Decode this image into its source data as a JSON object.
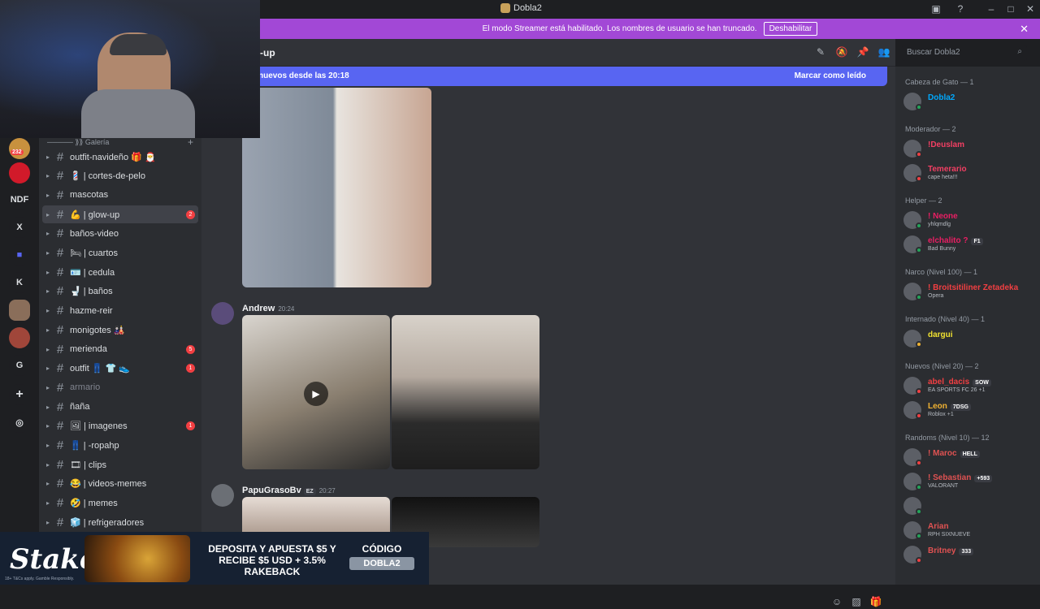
{
  "window": {
    "title": "Dobla2"
  },
  "banner": {
    "text": "El modo Streamer está habilitado. Los nombres de usuario se han truncado.",
    "button": "Deshabilitar"
  },
  "servers": [
    {
      "label": "232"
    },
    {
      "label": ""
    },
    {
      "label": "NDF"
    },
    {
      "label": "X"
    },
    {
      "label": ""
    },
    {
      "label": "K"
    },
    {
      "label": ""
    },
    {
      "label": ""
    },
    {
      "label": "G"
    },
    {
      "label": "+"
    },
    {
      "label": ""
    }
  ],
  "category": {
    "label": "───── ⟫⟫ Galería"
  },
  "channels": [
    {
      "label": "outfit-navideño 🎁 🎅",
      "badge": ""
    },
    {
      "label": "💈 | cortes-de-pelo",
      "badge": ""
    },
    {
      "label": "mascotas",
      "badge": ""
    },
    {
      "label": "💪 | glow-up",
      "badge": "2",
      "active": true
    },
    {
      "label": "baños-video",
      "badge": ""
    },
    {
      "label": "🛏 | cuartos",
      "badge": ""
    },
    {
      "label": "🪪 | cedula",
      "badge": ""
    },
    {
      "label": "🚽 | baños",
      "badge": ""
    },
    {
      "label": "hazme-reir",
      "badge": ""
    },
    {
      "label": "monigotes 🎎",
      "badge": ""
    },
    {
      "label": "merienda",
      "badge": "5"
    },
    {
      "label": "outfit 👖 👕 👟",
      "badge": "1"
    },
    {
      "label": "armario",
      "badge": "",
      "muted": true
    },
    {
      "label": "ñaña",
      "badge": ""
    },
    {
      "label": "🖼 | imagenes",
      "badge": "1"
    },
    {
      "label": "👖 | -ropahp",
      "badge": ""
    },
    {
      "label": "🎞 | clips",
      "badge": ""
    },
    {
      "label": "😂 | videos-memes",
      "badge": ""
    },
    {
      "label": "🤣 | memes",
      "badge": ""
    },
    {
      "label": "🧊 | refrigeradores",
      "badge": ""
    }
  ],
  "chat": {
    "channel_name": "-up",
    "search_placeholder": "Buscar Dobla2",
    "new_messages": "nuevos desde las 20:18",
    "mark_read": "Marcar como leído",
    "messages": [
      {
        "author": "Andrew",
        "time": "20:24",
        "tag": ""
      },
      {
        "author": "PapuGrasoBv",
        "time": "20:27",
        "tag": "EZ"
      }
    ]
  },
  "members": {
    "groups": [
      {
        "title": "Cabeza de Gato — 1",
        "users": [
          {
            "name": "Dobla2",
            "sub": "",
            "tag": "",
            "color": "#00a8fc",
            "status": "#23a55a"
          }
        ]
      },
      {
        "title": "Moderador — 2",
        "users": [
          {
            "name": "!Deuslam",
            "sub": "",
            "tag": "",
            "color": "#f23f63",
            "status": "#f23f42"
          },
          {
            "name": "Temerario",
            "sub": "cape heta!!!",
            "tag": "",
            "color": "#f23f63",
            "status": "#f23f42"
          }
        ]
      },
      {
        "title": "Helper — 2",
        "users": [
          {
            "name": "! Neone",
            "sub": "yhlqmdlg",
            "tag": "",
            "color": "#e91e63",
            "status": "#23a55a"
          },
          {
            "name": "elchalito ?",
            "sub": "Bad Bunny",
            "tag": "F1",
            "color": "#e91e63",
            "status": "#23a55a"
          }
        ]
      },
      {
        "title": "Narco (Nivel 100) — 1",
        "users": [
          {
            "name": "! Broitsitiliner Zetadeka",
            "sub": "Opera",
            "tag": "",
            "color": "#f23f42",
            "status": "#23a55a"
          }
        ]
      },
      {
        "title": "Internado (Nivel 40) — 1",
        "users": [
          {
            "name": "dargui",
            "sub": "",
            "tag": "",
            "color": "#f0e130",
            "status": "#f0b232"
          }
        ]
      },
      {
        "title": "Nuevos (Nivel 20) — 2",
        "users": [
          {
            "name": "abel_dacis",
            "sub": "EA SPORTS FC 26 +1",
            "tag": "SOW",
            "color": "#f23f42",
            "status": "#f23f42"
          },
          {
            "name": "Leon",
            "sub": "Roblox +1",
            "tag": "7DSG",
            "color": "#f0b232",
            "status": "#f23f42"
          }
        ]
      },
      {
        "title": "Randoms (Nivel 10) — 12",
        "users": [
          {
            "name": "! Maroc",
            "sub": "",
            "tag": "HELL",
            "color": "#e05252",
            "status": "#f23f42"
          },
          {
            "name": "! Sebastian",
            "sub": "VALORANT",
            "tag": "+593",
            "color": "#e05252",
            "status": "#23a55a"
          },
          {
            "name": "",
            "sub": "",
            "tag": "",
            "color": "#e05252",
            "status": "#23a55a"
          },
          {
            "name": "Arian",
            "sub": "RPH SIXNUEVE",
            "tag": "",
            "color": "#e05252",
            "status": "#23a55a"
          },
          {
            "name": "Britney",
            "sub": "",
            "tag": "333",
            "color": "#e05252",
            "status": "#f23f42"
          }
        ]
      }
    ]
  },
  "ad": {
    "logo": "Stake",
    "promo": "DEPOSITA Y APUESTA $5 Y RECIBE $5 USD + 3.5% RAKEBACK",
    "code_label": "CÓDIGO",
    "code_value": "DOBLA2",
    "small": "18+ T&Cs apply. Gamble Responsibly."
  }
}
